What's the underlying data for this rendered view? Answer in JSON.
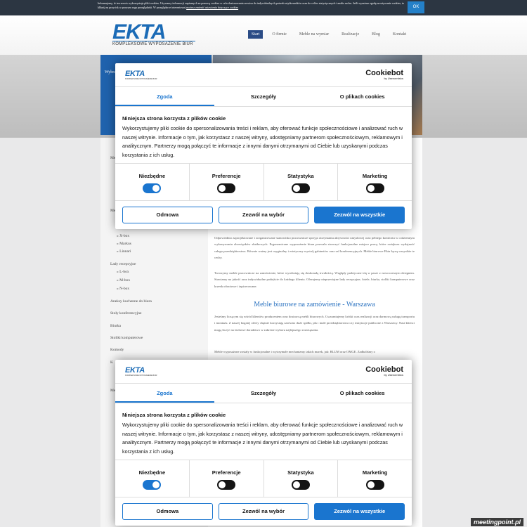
{
  "cookie_bar": {
    "text": "Informujemy, iż ten serwis wykorzystuje pliki cookies. Używamy informacji zapisanych za pomocą cookies w celu dostosowania serwisu do indywidualnych potrzeb użytkowników oraz do celów statystycznych i analiz ruchu. Jeśli wyrażasz zgodę na używanie cookies, to kliknij na przycisk w prawym rogu przeglądarki. W przeglądarce internetowej",
    "link": "możesz zmienić ustawienia dotyczące cookies",
    "ok": "OK"
  },
  "header": {
    "logo": "EKTA",
    "logo_sub": "KOMPLEKSOWE WYPOSAŻENIE BIUR",
    "nav": [
      "Start",
      "O firmie",
      "Meble na wymiar",
      "Realizacje",
      "Blog",
      "Kontakt"
    ]
  },
  "hero": {
    "blue_label": "Wybra"
  },
  "sidebar": {
    "items": [
      "Me",
      "Me",
      "X-box",
      "Markus",
      "Linnari",
      "Lady recepcyjne",
      "L-box",
      "M-box",
      "N-box",
      "Aneksy kuchenne do biura",
      "Stoły konferencyjne",
      "Biurka",
      "Stoliki komputerowe",
      "Komody",
      "K",
      "Me"
    ]
  },
  "content": {
    "p1": "Odpowiednio zaprojektowane i zorganizowane stanowisko pracownicze sprzyja otrzymaniu aktywności umysłowej oraz pełnego komfortu w codziennym wykonywaniu obowiązków służbowych. Ergonomiczne wyposażenie biura pozwala stworzyć funkcjonalne miejsce pracy, które zwiększa wydajność całego przedsiębiorstwa. Równie ważny jest oryginalny i estetyczny wystrój gabinetów oraz sal konferencyjnych. Meble biurowe Ekta łączą wszystkie te cechy.",
    "p2": "Tworzymy meble pracownicze na zamówienie, które wyróżniają się doskonałą trwałością. Względy praktyczne idą w parze z nowoczesnym designem. Stawiamy na jakość oraz indywidualne podejście do każdego klienta. Oferujemy nieprzeciętne lady recepcyjne, fotele, biurka, stoliki komputerowe oraz krzesła obrotowe i tapicerowane.",
    "h2": "Meble biurowe na zamówienie - Warszawa",
    "p3": "Jesteśmy liczącym się wśród klientów producentem oraz dostawcą mebli biurowych. Gwarantujemy krótki czas realizacji oraz darmową usługę transportu i montażu. Z naszej bogatej oferty chętnie korzystają zarówno duże spółki, jak i małe przedsiębiorstwa czy instytucje publiczne z Warszawy. Nasi klienci mogą liczyć na fachowe doradztwo w zakresie wyboru najlepszego rozwiązania.",
    "p4": "Meble wyposażone zostały w funkcjonalne i wytrzymałe mechanizmy takich marek, jak: BLUM oraz OMGE. Zadbaliśmy o"
  },
  "cookiebot": {
    "logo": "EKTA",
    "logo_sub": "KOMPLEKSOWE WYPOSAŻENIE BIUR",
    "brand": "Cookiebot",
    "brand_sub": "by Usercentrics",
    "tabs": [
      "Zgoda",
      "Szczegóły",
      "O plikach cookies"
    ],
    "title": "Niniejsza strona korzysta z plików cookie",
    "body": "Wykorzystujemy pliki cookie do spersonalizowania treści i reklam, aby oferować funkcje społecznościowe i analizować ruch w naszej witrynie. Informacje o tym, jak korzystasz z naszej witryny, udostępniamy partnerom społecznościowym, reklamowym i analitycznym. Partnerzy mogą połączyć te informacje z innymi danymi otrzymanymi od Ciebie lub uzyskanymi podczas korzystania z ich usług.",
    "toggles": [
      "Niezbędne",
      "Preferencje",
      "Statystyka",
      "Marketing"
    ],
    "buttons": {
      "deny": "Odmowa",
      "allow_selection": "Zezwól na wybór",
      "allow_all": "Zezwól na wszystkie"
    }
  },
  "watermark": "meetingpoint.pl"
}
